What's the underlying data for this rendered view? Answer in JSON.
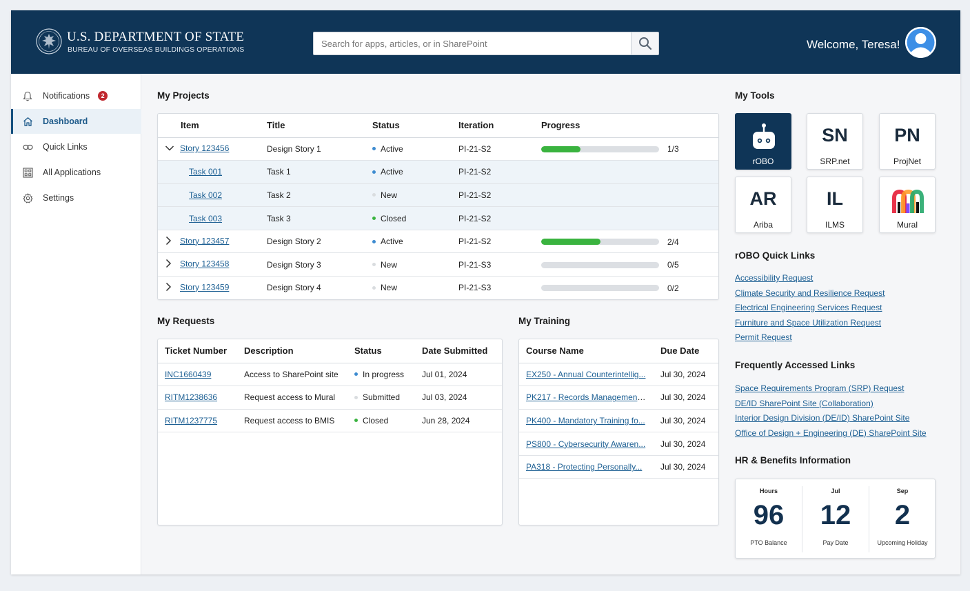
{
  "header": {
    "org_name": "U.S. DEPARTMENT OF STATE",
    "org_sub": "BUREAU OF OVERSEAS BUILDINGS OPERATIONS",
    "search_placeholder": "Search for apps, articles, or in SharePoint",
    "search_icon": "search-icon",
    "welcome": "Welcome, Teresa!",
    "avatar_icon": "user-avatar-icon",
    "brand_color": "#0f3557"
  },
  "sidebar": {
    "items": [
      {
        "label": "Notifications",
        "icon": "bell-icon",
        "badge": "2"
      },
      {
        "label": "Dashboard",
        "icon": "home-icon",
        "active": true
      },
      {
        "label": "Quick Links",
        "icon": "link-icon"
      },
      {
        "label": "All Applications",
        "icon": "grid-icon"
      },
      {
        "label": "Settings",
        "icon": "gear-icon"
      }
    ],
    "accent_color": "#14507f"
  },
  "projects": {
    "title": "My Projects",
    "columns": [
      "Item",
      "Title",
      "Status",
      "Iteration",
      "Progress"
    ],
    "rows": [
      {
        "item": "Story 123456",
        "title": "Design Story 1",
        "status": "Active",
        "iteration": "PI-21-S2",
        "progress": "1/3",
        "progress_fraction": 0.333,
        "expanded": true
      },
      {
        "item": "Task 001",
        "title": "Task 1",
        "status": "Active",
        "iteration": "PI-21-S2",
        "sub": true
      },
      {
        "item": "Task 002",
        "title": "Task 2",
        "status": "New",
        "iteration": "PI-21-S2",
        "sub": true
      },
      {
        "item": "Task 003",
        "title": "Task 3",
        "status": "Closed",
        "iteration": "PI-21-S2",
        "sub": true
      },
      {
        "item": "Story 123457",
        "title": "Design Story 2",
        "status": "Active",
        "iteration": "PI-21-S2",
        "progress": "2/4",
        "progress_fraction": 0.5
      },
      {
        "item": "Story 123458",
        "title": "Design Story 3",
        "status": "New",
        "iteration": "PI-21-S3",
        "progress": "0/5",
        "progress_fraction": 0
      },
      {
        "item": "Story 123459",
        "title": "Design Story 4",
        "status": "New",
        "iteration": "PI-21-S3",
        "progress": "0/2",
        "progress_fraction": 0
      }
    ]
  },
  "requests": {
    "title": "My Requests",
    "columns": [
      "Ticket Number",
      "Description",
      "Status",
      "Date Submitted"
    ],
    "rows": [
      {
        "ticket": "INC1660439",
        "description": "Access to SharePoint site",
        "status": "In progress",
        "date": "Jul 01, 2024"
      },
      {
        "ticket": "RITM1238636",
        "description": "Request access to Mural",
        "status": "Submitted",
        "date": "Jul 03, 2024"
      },
      {
        "ticket": "RITM1237775",
        "description": "Request access to BMIS",
        "status": "Closed",
        "date": "Jun 28, 2024"
      }
    ]
  },
  "training": {
    "title": "My Training",
    "columns": [
      "Course Name",
      "Due Date"
    ],
    "rows": [
      {
        "course": "EX250 - Annual Counterintellig...",
        "due": "Jul 30, 2024"
      },
      {
        "course": "PK217 - Records Management....",
        "due": "Jul 30, 2024"
      },
      {
        "course": "PK400 - Mandatory Training fo...",
        "due": "Jul 30, 2024"
      },
      {
        "course": "PS800 - Cybersecurity Awaren...",
        "due": "Jul 30, 2024"
      },
      {
        "course": "PA318 - Protecting Personally...",
        "due": "Jul 30, 2024"
      }
    ]
  },
  "status_colors": {
    "Active": "#3d8bd0",
    "In progress": "#3d8bd0",
    "New": "#d9dcdf",
    "Submitted": "#d9dcdf",
    "Closed": "#3ab33f"
  },
  "tools": {
    "title": "My Tools",
    "items": [
      {
        "abbr": "",
        "label": "rOBO",
        "icon": "robot-icon",
        "dark": true
      },
      {
        "abbr": "SN",
        "label": "SRP.net"
      },
      {
        "abbr": "PN",
        "label": "ProjNet"
      },
      {
        "abbr": "AR",
        "label": "Ariba"
      },
      {
        "abbr": "IL",
        "label": "ILMS"
      },
      {
        "abbr": "",
        "label": "Mural",
        "icon": "mural-logo-icon"
      }
    ]
  },
  "robo_links": {
    "title": "rOBO Quick Links",
    "items": [
      "Accessibility Request",
      "Climate Security and Resilience Request",
      "Electrical Engineering Services Request",
      "Furniture and Space Utilization Request",
      "Permit Request"
    ]
  },
  "freq_links": {
    "title": "Frequently Accessed Links",
    "items": [
      "Space Requirements Program (SRP) Request",
      "DE/ID SharePoint Site (Collaboration)",
      "Interior Design Division (DE/ID) SharePoint Site",
      "Office of Design + Engineering (DE) SharePoint Site"
    ]
  },
  "hr": {
    "title": "HR & Benefits Information",
    "stats": [
      {
        "top": "Hours",
        "value": "96",
        "bottom": "PTO Balance"
      },
      {
        "top": "Jul",
        "value": "12",
        "bottom": "Pay Date"
      },
      {
        "top": "Sep",
        "value": "2",
        "bottom": "Upcoming Holiday"
      }
    ]
  }
}
